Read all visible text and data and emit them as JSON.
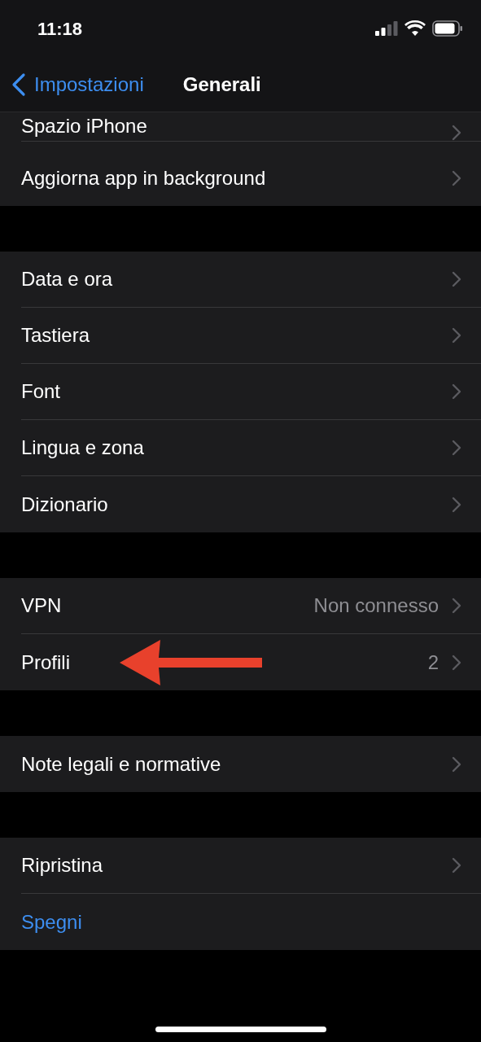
{
  "status_bar": {
    "time": "11:18"
  },
  "nav": {
    "back": "Impostazioni",
    "title": "Generali"
  },
  "groups": [
    {
      "rows": [
        {
          "kind": "nav",
          "label": "Spazio iPhone",
          "highlighted": false,
          "partial": true
        },
        {
          "kind": "nav",
          "label": "Aggiorna app in background",
          "highlighted": false,
          "partial": false
        }
      ]
    },
    {
      "rows": [
        {
          "kind": "nav",
          "label": "Data e ora",
          "highlighted": false,
          "partial": false
        },
        {
          "kind": "nav",
          "label": "Tastiera",
          "highlighted": false,
          "partial": false
        },
        {
          "kind": "nav",
          "label": "Font",
          "highlighted": false,
          "partial": false
        },
        {
          "kind": "nav",
          "label": "Lingua e zona",
          "highlighted": false,
          "partial": false
        },
        {
          "kind": "nav",
          "label": "Dizionario",
          "highlighted": false,
          "partial": false
        }
      ]
    },
    {
      "rows": [
        {
          "kind": "nav",
          "label": "VPN",
          "value": "Non connesso",
          "highlighted": false,
          "partial": false
        },
        {
          "kind": "nav",
          "label": "Profili",
          "value": "2",
          "highlighted": true,
          "partial": false
        }
      ]
    },
    {
      "rows": [
        {
          "kind": "nav",
          "label": "Note legali e normative",
          "highlighted": false,
          "partial": false
        }
      ]
    },
    {
      "rows": [
        {
          "kind": "nav",
          "label": "Ripristina",
          "highlighted": false,
          "partial": false
        },
        {
          "kind": "action",
          "label": "Spegni"
        }
      ]
    }
  ]
}
